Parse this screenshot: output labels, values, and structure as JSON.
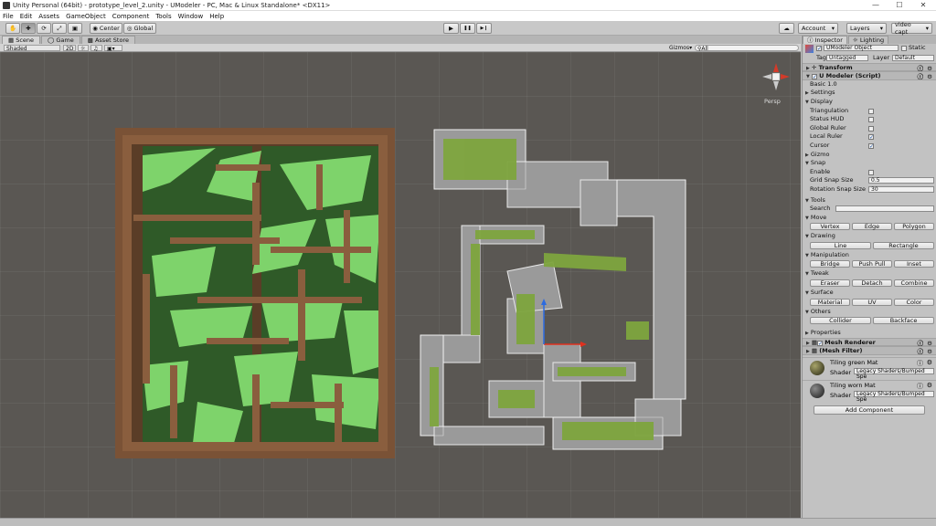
{
  "window": {
    "title": "Unity Personal (64bit) - prototype_level_2.unity - UModeler - PC, Mac & Linux Standalone* <DX11>",
    "minimize": "—",
    "maximize": "☐",
    "close": "✕"
  },
  "menu": [
    "File",
    "Edit",
    "Assets",
    "GameObject",
    "Component",
    "Tools",
    "Window",
    "Help"
  ],
  "toolbar": {
    "pivot_label": "Center",
    "space_label": "Global",
    "play_icon": "▶",
    "pause_icon": "❚❚",
    "step_icon": "▶❙",
    "cloud_icon": "☁",
    "account_label": "Account",
    "layers_label": "Layers",
    "layout_label": "video capt"
  },
  "tabs": {
    "scene": "Scene",
    "game": "Game",
    "asset_store": "Asset Store"
  },
  "scene_options": {
    "shading": "Shaded",
    "mode_2d": "2D",
    "gizmos": "Gizmos",
    "search_all": "All",
    "persp": "Persp"
  },
  "inspector": {
    "tab_inspector": "Inspector",
    "tab_lighting": "Lighting",
    "object_name": "UModeler Object",
    "static_label": "Static",
    "tag_label": "Tag",
    "tag_value": "Untagged",
    "layer_label": "Layer",
    "layer_value": "Default",
    "transform": "Transform",
    "umodeler_script": "U Modeler (Script)",
    "version": "Basic 1.0",
    "settings": "Settings",
    "display": "Display",
    "triangulation": "Triangulation",
    "status_hud": "Status HUD",
    "global_ruler": "Global Ruler",
    "local_ruler": "Local Ruler",
    "cursor": "Cursor",
    "gizmo": "Gizmo",
    "snap": "Snap",
    "enable": "Enable",
    "grid_snap_size": "Grid Snap Size",
    "grid_snap_value": "0.5",
    "rotation_snap_size": "Rotation Snap Size",
    "rotation_snap_value": "30",
    "tools": "Tools",
    "search": "Search",
    "move": "Move",
    "vertex": "Vertex",
    "edge": "Edge",
    "polygon": "Polygon",
    "drawing": "Drawing",
    "line": "Line",
    "rectangle": "Rectangle",
    "manipulation": "Manipulation",
    "bridge": "Bridge",
    "push_pull": "Push Pull",
    "inset": "Inset",
    "tweak": "Tweak",
    "eraser": "Eraser",
    "detach": "Detach",
    "combine": "Combine",
    "surface": "Surface",
    "material": "Material",
    "uv": "UV",
    "color": "Color",
    "others": "Others",
    "collider": "Collider",
    "backface": "Backface",
    "properties": "Properties",
    "mesh_renderer": "Mesh Renderer",
    "mesh_filter": "(Mesh Filter)",
    "mat1_name": "Tiling green Mat",
    "mat2_name": "Tiling worn Mat",
    "shader_label": "Shader",
    "shader_value": "Legacy Shaders/Bumped Spe",
    "add_component": "Add Component"
  },
  "colors": {
    "viewport_bg": "#5a5753",
    "grass_light": "#7ed36b",
    "grass_dark": "#2f5a28",
    "dirt": "#7a5236",
    "stone": "#9a9a9a"
  }
}
